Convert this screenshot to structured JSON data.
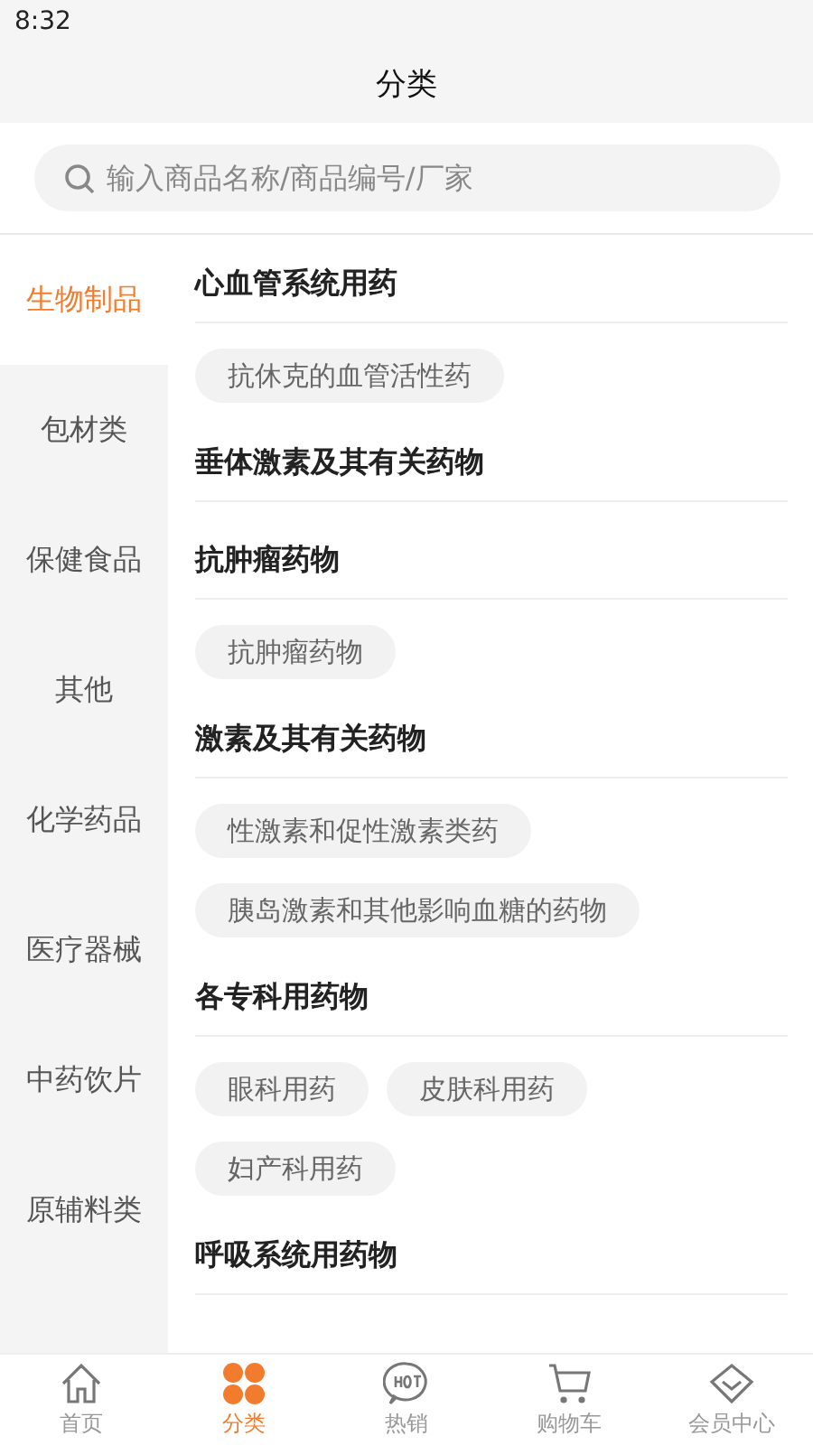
{
  "status_bar": {
    "time": "8:32"
  },
  "header": {
    "title": "分类"
  },
  "search": {
    "placeholder": "输入商品名称/商品编号/厂家"
  },
  "sidebar": {
    "items": [
      {
        "label": "生物制品",
        "selected": true
      },
      {
        "label": "包材类",
        "selected": false
      },
      {
        "label": "保健食品",
        "selected": false
      },
      {
        "label": "其他",
        "selected": false
      },
      {
        "label": "化学药品",
        "selected": false
      },
      {
        "label": "医疗器械",
        "selected": false
      },
      {
        "label": "中药饮片",
        "selected": false
      },
      {
        "label": "原辅料类",
        "selected": false
      }
    ]
  },
  "sections": [
    {
      "title": "心血管系统用药",
      "chips": [
        "抗休克的血管活性药"
      ]
    },
    {
      "title": "垂体激素及其有关药物"
    },
    {
      "title": "抗肿瘤药物",
      "chips": [
        "抗肿瘤药物"
      ]
    },
    {
      "title": "激素及其有关药物",
      "chips": [
        "性激素和促性激素类药",
        "胰岛激素和其他影响血糖的药物"
      ]
    },
    {
      "title": "各专科用药物",
      "chips": [
        "眼科用药",
        "皮肤科用药",
        "妇产科用药"
      ]
    },
    {
      "title": "呼吸系统用药物"
    }
  ],
  "tab_bar": [
    {
      "kind": "home",
      "label": "首页",
      "selected": false
    },
    {
      "kind": "category",
      "label": "分类",
      "selected": true
    },
    {
      "kind": "hot",
      "label": "热销",
      "selected": false
    },
    {
      "kind": "cart",
      "label": "购物车",
      "selected": false
    },
    {
      "kind": "member",
      "label": "会员中心",
      "selected": false
    }
  ]
}
